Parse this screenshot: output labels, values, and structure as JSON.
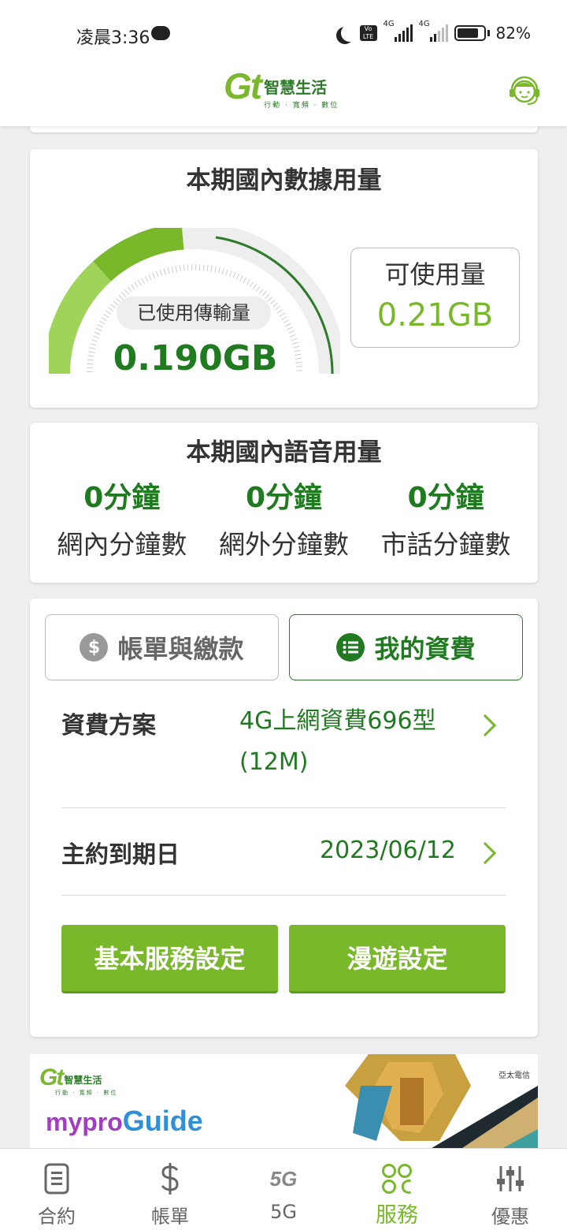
{
  "status_bar": {
    "time": "凌晨3:36",
    "network_1": "4G",
    "network_2": "4G",
    "volte": "Vo LTE",
    "battery": "82%"
  },
  "header": {
    "logo_mark": "Gt",
    "logo_name": "智慧生活",
    "logo_tagline": "行動 · 寬頻 · 數位"
  },
  "data_usage": {
    "title": "本期國內數據用量",
    "used_label": "已使用傳輸量",
    "used_value": "0.190GB",
    "available_label": "可使用量",
    "available_value": "0.21GB",
    "used_fraction": 0.475
  },
  "voice_usage": {
    "title": "本期國內語音用量",
    "items": [
      {
        "value": "0分鐘",
        "label": "網內分鐘數"
      },
      {
        "value": "0分鐘",
        "label": "網外分鐘數"
      },
      {
        "value": "0分鐘",
        "label": "市話分鐘數"
      }
    ]
  },
  "plan_card": {
    "tab_bill": "帳單與繳款",
    "tab_plan": "我的資費",
    "tab_bill_icon": "$",
    "plan_label": "資費方案",
    "plan_value_line1": "4G上網資費696型",
    "plan_value_line2": "(12M)",
    "expiry_label": "主約到期日",
    "expiry_value": "2023/06/12",
    "btn_basic": "基本服務設定",
    "btn_roaming": "漫遊設定"
  },
  "banner": {
    "logo_mark": "Gt",
    "logo_name": "智慧生活",
    "logo_tagline": "行動 · 寬頻 · 數位",
    "guide_prefix": "mypro",
    "guide_suffix": "Guide",
    "corp": "亞太電信"
  },
  "bottom_nav": [
    {
      "label": "合約",
      "icon": "contract-icon"
    },
    {
      "label": "帳單",
      "icon": "dollar-icon"
    },
    {
      "label": "5G",
      "icon": "5g-icon"
    },
    {
      "label": "服務",
      "icon": "service-grid-icon",
      "active": true
    },
    {
      "label": "優惠",
      "icon": "sliders-icon"
    }
  ],
  "colors": {
    "brand_green": "#78b82a",
    "dark_green": "#1f7a20"
  }
}
